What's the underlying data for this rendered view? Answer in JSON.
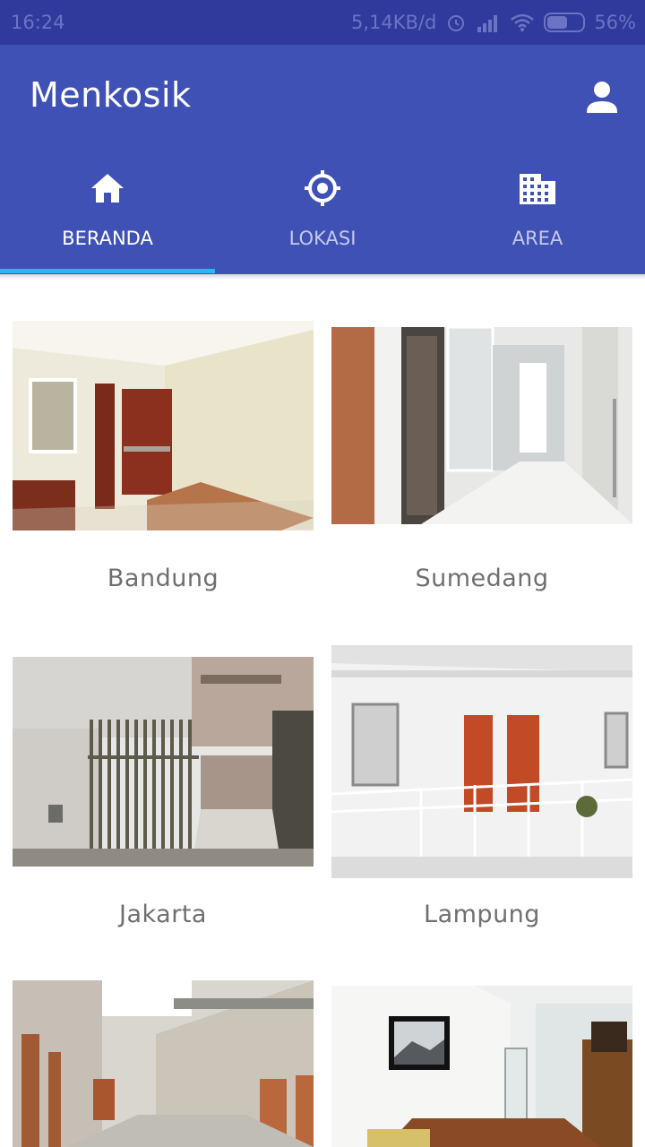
{
  "status_bar": {
    "time": "16:24",
    "net_speed": "5,14KB/d",
    "battery": "56%",
    "battery_level": 0.56
  },
  "app": {
    "title": "Menkosik"
  },
  "tabs": [
    {
      "label": "BERANDA",
      "icon": "home-icon",
      "active": true
    },
    {
      "label": "LOKASI",
      "icon": "gps-target-icon",
      "active": false
    },
    {
      "label": "AREA",
      "icon": "building-icon",
      "active": false
    }
  ],
  "colors": {
    "primary": "#3f51b5",
    "primary_dark": "#2f3a9c",
    "indicator": "#29b6f6"
  },
  "cities": [
    {
      "name": "Bandung"
    },
    {
      "name": "Sumedang"
    },
    {
      "name": "Jakarta"
    },
    {
      "name": "Lampung"
    },
    {
      "name": ""
    },
    {
      "name": ""
    }
  ]
}
